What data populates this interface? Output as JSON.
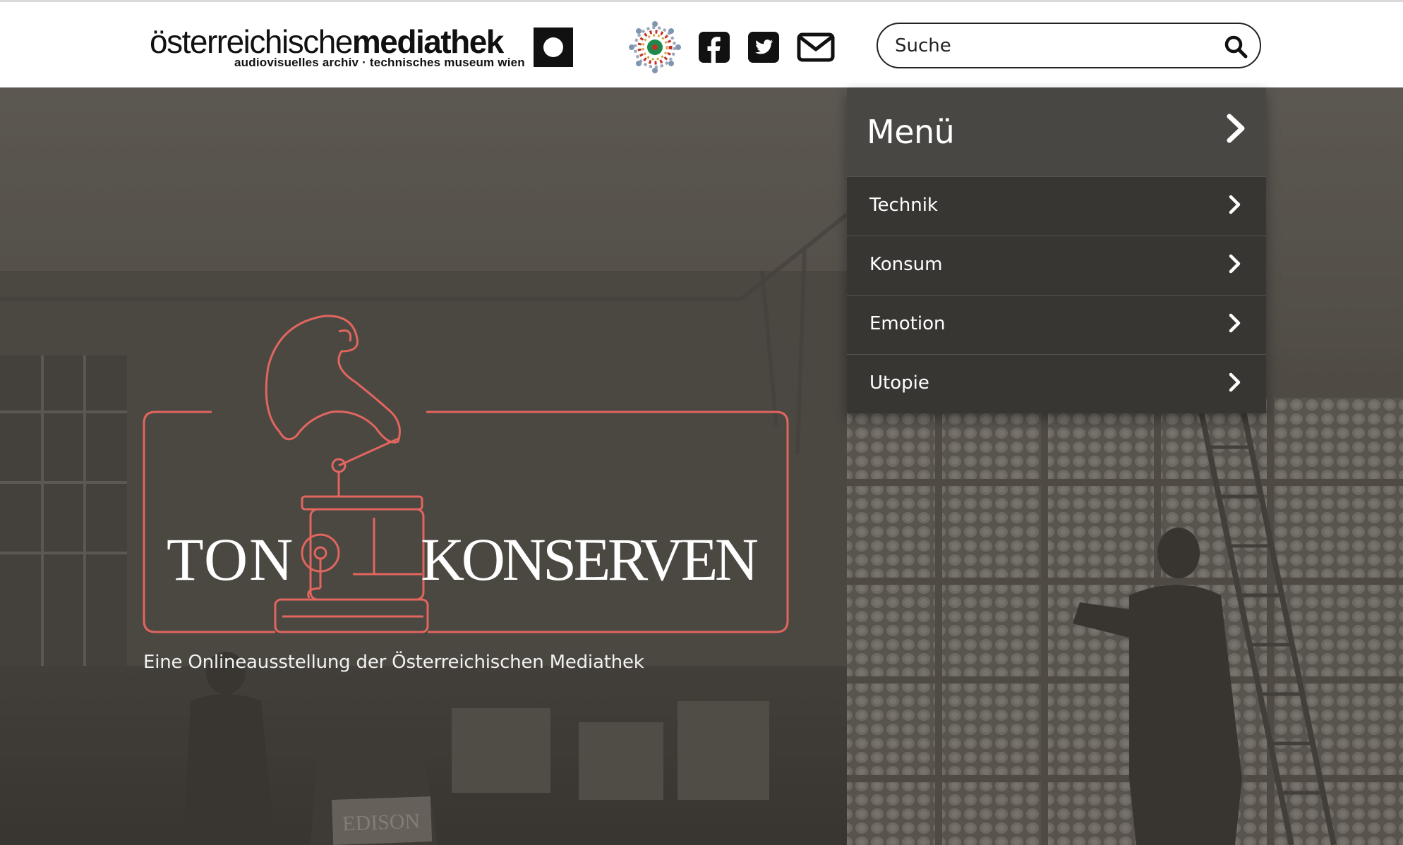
{
  "header": {
    "logo": {
      "light": "österreichische",
      "bold": "mediathek",
      "sub": "audiovisuelles archiv · technisches museum wien"
    },
    "icons": {
      "partner_logo": "rosette-logo-icon",
      "facebook": "facebook-icon",
      "twitter": "twitter-icon",
      "mail": "mail-icon"
    },
    "search": {
      "placeholder": "Suche",
      "icon": "search-icon"
    }
  },
  "hero": {
    "title_left": "TON",
    "title_right": "KONSERVEN",
    "tagline": "Eine Onlineausstellung der Österreichischen Mediathek",
    "crate_label": "EDISON"
  },
  "menu": {
    "title": "Menü",
    "items": [
      {
        "label": "Technik"
      },
      {
        "label": "Konsum"
      },
      {
        "label": "Emotion"
      },
      {
        "label": "Utopie"
      }
    ]
  },
  "colors": {
    "logo_outline": "#e0665f",
    "menu_header_bg": "#494744",
    "menu_item_bg": "#383633"
  }
}
